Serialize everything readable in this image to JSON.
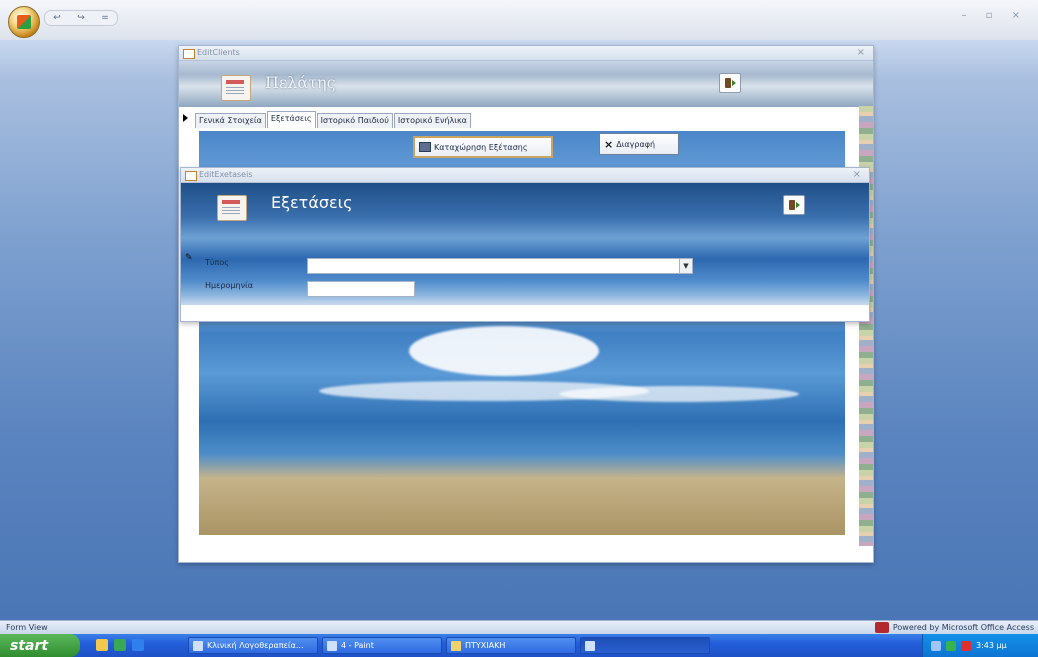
{
  "app": {
    "quick_access": [
      "↩",
      "↪",
      "="
    ],
    "window_controls": "– ▫ ×"
  },
  "clients_window": {
    "title": "EditClients",
    "header_title": "Πελάτης",
    "tabs": [
      {
        "label": "Γενικά Στοιχεία",
        "active": false
      },
      {
        "label": "Εξετάσεις",
        "active": true
      },
      {
        "label": "Ιστορικό Παιδιού",
        "active": false
      },
      {
        "label": "Ιστορικό Ενήλικα",
        "active": false
      }
    ],
    "buttons": {
      "register_exam": "Καταχώρηση Εξέτασης",
      "delete": "Διαγραφή"
    }
  },
  "exams_window": {
    "title": "EditExetaseis",
    "header_title": "Εξετάσεις",
    "fields": {
      "type_label": "Τύπος",
      "type_value": "",
      "date_label": "Ημερομηνία",
      "date_value": ""
    }
  },
  "statusbar": {
    "left": "Form View",
    "right": "Powered by Microsoft Office Access"
  },
  "taskbar": {
    "start": "start",
    "items": [
      {
        "label": "Κλινική Λογοθεραπεία..."
      },
      {
        "label": "4 - Paint"
      },
      {
        "label": "ΠΤΥΧΙΑΚΗ"
      },
      {
        "label": ""
      }
    ],
    "clock": "3:43 μμ"
  },
  "colors": {
    "workspace": "#5a84bf",
    "taskbar": "#245edb",
    "accent_button_border": "#caa463"
  }
}
